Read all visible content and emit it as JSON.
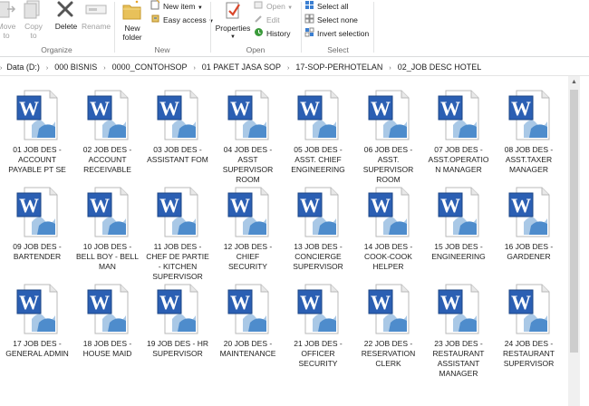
{
  "ribbon": {
    "organize": {
      "label": "Organize",
      "move_to": "Move\nto",
      "copy_to": "Copy\nto",
      "delete": "Delete",
      "rename": "Rename"
    },
    "new": {
      "label": "New",
      "new_folder_line1": "New",
      "new_folder_line2": "folder",
      "new_item": "New item",
      "easy_access": "Easy access"
    },
    "open": {
      "label": "Open",
      "properties": "Properties",
      "open": "Open",
      "edit": "Edit",
      "history": "History"
    },
    "select": {
      "label": "Select",
      "select_all": "Select all",
      "select_none": "Select none",
      "invert_selection": "Invert selection"
    }
  },
  "breadcrumb": [
    "Data (D:)",
    "000 BISNIS",
    "0000_CONTOHSOP",
    "01 PAKET JASA SOP",
    "17-SOP-PERHOTELAN",
    "02_JOB DESC HOTEL"
  ],
  "files": [
    [
      "01 JOB DES -",
      "ACCOUNT",
      "PAYABLE PT SE"
    ],
    [
      "02 JOB DES -",
      "ACCOUNT",
      "RECEIVABLE"
    ],
    [
      "03 JOB DES -",
      "ASSISTANT FOM"
    ],
    [
      "04 JOB DES -",
      "ASST",
      "SUPERVISOR",
      "ROOM"
    ],
    [
      "05 JOB DES -",
      "ASST. CHIEF",
      "ENGINEERING"
    ],
    [
      "06 JOB DES -",
      "ASST.",
      "SUPERVISOR",
      "ROOM"
    ],
    [
      "07 JOB DES -",
      "ASST.OPERATIO",
      "N MANAGER"
    ],
    [
      "08 JOB DES -",
      "ASST.TAXER",
      "MANAGER"
    ],
    [
      "09 JOB DES -",
      "BARTENDER"
    ],
    [
      "10 JOB DES -",
      "BELL BOY - BELL",
      "MAN"
    ],
    [
      "11 JOB DES -",
      "CHEF DE PARTIE",
      "- KITCHEN",
      "SUPERVISOR"
    ],
    [
      "12 JOB DES -",
      "CHIEF SECURITY"
    ],
    [
      "13 JOB DES -",
      "CONCIERGE",
      "SUPERVISOR"
    ],
    [
      "14 JOB DES -",
      "COOK-COOK",
      "HELPER"
    ],
    [
      "15 JOB DES -",
      "ENGINEERING"
    ],
    [
      "16 JOB DES -",
      "GARDENER"
    ],
    [
      "17 JOB DES -",
      "GENERAL ADMIN"
    ],
    [
      "18 JOB DES -",
      "HOUSE MAID"
    ],
    [
      "19 JOB DES - HR",
      "SUPERVISOR"
    ],
    [
      "20 JOB DES -",
      "MAINTENANCE"
    ],
    [
      "21 JOB DES -",
      "OFFICER",
      "SECURITY"
    ],
    [
      "22 JOB DES -",
      "RESERVATION",
      "CLERK"
    ],
    [
      "23 JOB DES -",
      "RESTAURANT",
      "ASSISTANT",
      "MANAGER"
    ],
    [
      "24 JOB DES -",
      "RESTAURANT",
      "SUPERVISOR"
    ]
  ],
  "icon": {
    "name": "word-document-icon",
    "glyph": "W"
  },
  "colors": {
    "word_blue": "#2b5fb3",
    "ribbon_label": "#6d6d6d"
  }
}
